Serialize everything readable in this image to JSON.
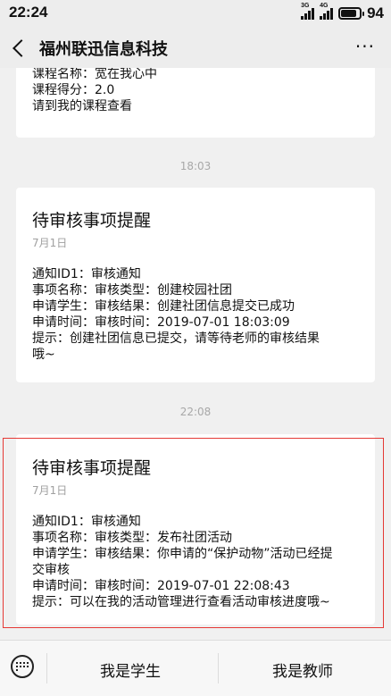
{
  "status": {
    "time": "22:24",
    "net1": "3G",
    "net2": "4G",
    "battery": "94",
    "battery_level": 0.94
  },
  "nav": {
    "title": "福州联迅信息科技",
    "more": "···"
  },
  "messages": [
    {
      "lines": [
        "课程名称：宽在我心中",
        "课程得分：2.0",
        "请到我的课程查看"
      ]
    },
    {
      "time": "18:03",
      "title": "待审核事项提醒",
      "date": "7月1日",
      "lines": [
        "通知ID1：审核通知",
        "事项名称：审核类型：创建校园社团",
        "申请学生：审核结果：创建社团信息提交已成功",
        "申请时间：审核时间：2019-07-01 18:03:09",
        "提示：创建社团信息已提交，请等待老师的审核结果",
        "哦~"
      ]
    },
    {
      "time": "22:08",
      "title": "待审核事项提醒",
      "date": "7月1日",
      "lines": [
        "通知ID1：审核通知",
        "事项名称：审核类型：发布社团活动",
        "申请学生：审核结果：你申请的“保护动物”活动已经提",
        "交审核",
        "申请时间：审核时间：2019-07-01 22:08:43",
        "提示：可以在我的活动管理进行查看活动审核进度哦~"
      ]
    }
  ],
  "bottom": {
    "btn1": "我是学生",
    "btn2": "我是教师"
  }
}
